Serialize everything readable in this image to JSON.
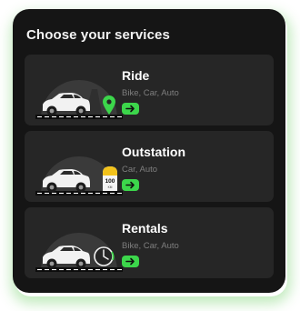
{
  "title": "Choose your services",
  "accent_color": "#3cd64b",
  "services": [
    {
      "label": "Ride",
      "subtitle": "Bike, Car, Auto",
      "icon": "map-pin-icon",
      "arrow": "arrow-right-icon"
    },
    {
      "label": "Outstation",
      "subtitle": "Car, Auto",
      "icon": "milestone-icon",
      "milestone_value": "100",
      "milestone_unit": "KM",
      "arrow": "arrow-right-icon"
    },
    {
      "label": "Rentals",
      "subtitle": "Bike, Car, Auto",
      "icon": "clock-icon",
      "arrow": "arrow-right-icon"
    }
  ]
}
